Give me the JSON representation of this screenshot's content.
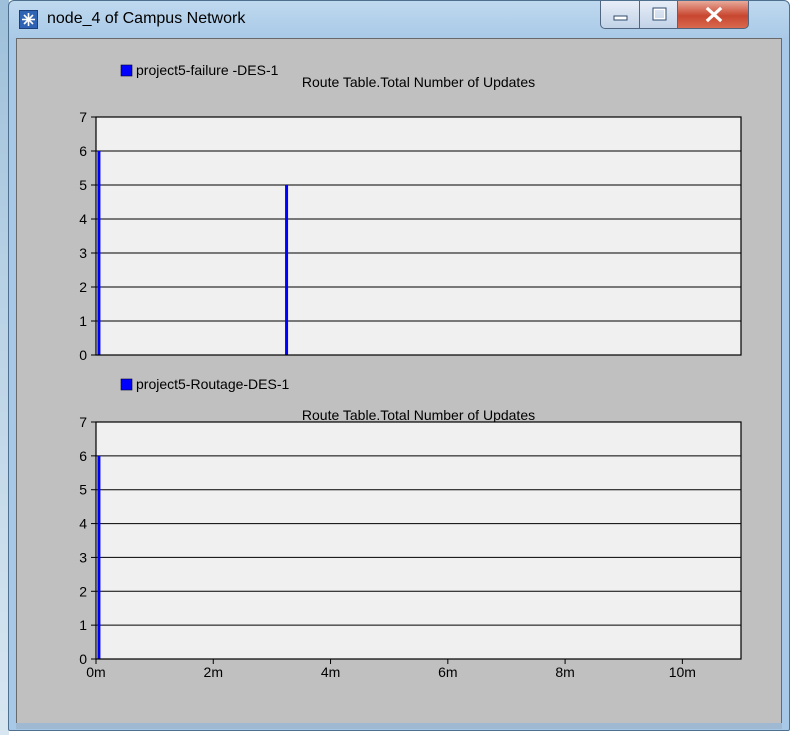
{
  "window": {
    "title": "node_4 of Campus Network",
    "app_icon": "star-burst-icon",
    "controls": [
      "minimize-icon",
      "maximize-icon",
      "close-icon"
    ]
  },
  "colors": {
    "series": "#0000ff",
    "plot_background": "#f0f0f0",
    "panel_background": "#c0c0c0",
    "gridline": "#000000"
  },
  "chart_data": [
    {
      "type": "bar",
      "legend": "project5-failure -DES-1",
      "title": "Route Table.Total Number of Updates",
      "xlabel": "",
      "ylabel": "",
      "ylim": [
        0,
        7
      ],
      "yticks": [
        "0",
        "1",
        "2",
        "3",
        "4",
        "5",
        "6",
        "7"
      ],
      "xlim_minutes": [
        0,
        11
      ],
      "xtick_labels": [],
      "grid": true,
      "series": [
        {
          "name": "project5-failure -DES-1",
          "x_minutes": [
            0.05,
            3.25
          ],
          "values": [
            6,
            5
          ]
        }
      ]
    },
    {
      "type": "bar",
      "legend": "project5-Routage-DES-1",
      "title": "Route Table.Total Number of Updates",
      "xlabel": "",
      "ylabel": "",
      "ylim": [
        0,
        7
      ],
      "yticks": [
        "0",
        "1",
        "2",
        "3",
        "4",
        "5",
        "6",
        "7"
      ],
      "xlim_minutes": [
        0,
        11
      ],
      "xticks_minutes": [
        0,
        2,
        4,
        6,
        8,
        10
      ],
      "xtick_labels": [
        "0m",
        "2m",
        "4m",
        "6m",
        "8m",
        "10m"
      ],
      "grid": true,
      "series": [
        {
          "name": "project5-Routage-DES-1",
          "x_minutes": [
            0.05
          ],
          "values": [
            6
          ]
        }
      ]
    }
  ]
}
